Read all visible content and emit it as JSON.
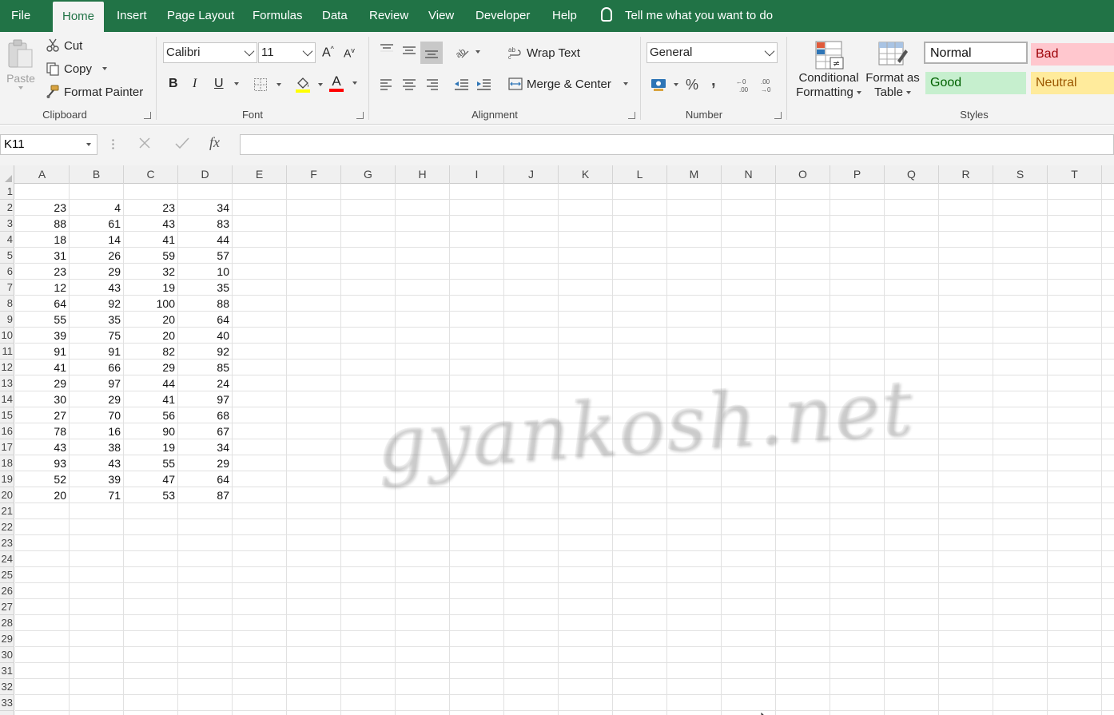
{
  "menu": {
    "tabs": [
      "File",
      "Home",
      "Insert",
      "Page Layout",
      "Formulas",
      "Data",
      "Review",
      "View",
      "Developer",
      "Help"
    ],
    "active_tab": "Home",
    "tell_me": "Tell me what you want to do"
  },
  "ribbon": {
    "clipboard": {
      "label": "Clipboard",
      "paste": "Paste",
      "cut": "Cut",
      "copy": "Copy",
      "format_painter": "Format Painter"
    },
    "font": {
      "label": "Font",
      "font_name": "Calibri",
      "font_size": "11",
      "bold": "B",
      "italic": "I",
      "underline": "U",
      "font_color_glyph": "A"
    },
    "alignment": {
      "label": "Alignment",
      "wrap_text": "Wrap Text",
      "merge_center": "Merge & Center"
    },
    "number": {
      "label": "Number",
      "format": "General",
      "percent": "%",
      "comma": ","
    },
    "styles": {
      "label": "Styles",
      "conditional_formatting_line1": "Conditional",
      "conditional_formatting_line2": "Formatting",
      "format_as_table_line1": "Format as",
      "format_as_table_line2": "Table",
      "normal": "Normal",
      "bad": "Bad",
      "good": "Good",
      "neutral": "Neutral",
      "colors": {
        "normal_bg": "#ffffff",
        "bad_bg": "#ffc7ce",
        "bad_fg": "#9c0006",
        "good_bg": "#c6efce",
        "good_fg": "#006100",
        "neutral_bg": "#ffeb9c",
        "neutral_fg": "#9c5700"
      }
    }
  },
  "formula_bar": {
    "name_box": "K11",
    "fx": "fx",
    "formula": ""
  },
  "sheet": {
    "columns": [
      "A",
      "B",
      "C",
      "D",
      "E",
      "F",
      "G",
      "H",
      "I",
      "J",
      "K",
      "L",
      "M",
      "N",
      "O",
      "P",
      "Q",
      "R",
      "S",
      "T"
    ],
    "row_numbers": [
      "1",
      "2",
      "3",
      "4",
      "5",
      "6",
      "7",
      "8",
      "9",
      "10",
      "11",
      "12",
      "13",
      "14",
      "15",
      "16",
      "17",
      "18",
      "19",
      "20",
      "21",
      "22",
      "23",
      "24",
      "25",
      "26",
      "27",
      "28",
      "29",
      "30",
      "31",
      "32",
      "33"
    ],
    "data": [
      [
        23,
        4,
        23,
        34
      ],
      [
        88,
        61,
        43,
        83
      ],
      [
        18,
        14,
        41,
        44
      ],
      [
        31,
        26,
        59,
        57
      ],
      [
        23,
        29,
        32,
        10
      ],
      [
        12,
        43,
        19,
        35
      ],
      [
        64,
        92,
        100,
        88
      ],
      [
        55,
        35,
        20,
        64
      ],
      [
        39,
        75,
        20,
        40
      ],
      [
        91,
        91,
        82,
        92
      ],
      [
        41,
        66,
        29,
        85
      ],
      [
        29,
        97,
        44,
        24
      ],
      [
        30,
        29,
        41,
        97
      ],
      [
        27,
        70,
        56,
        68
      ],
      [
        78,
        16,
        90,
        67
      ],
      [
        43,
        38,
        19,
        34
      ],
      [
        93,
        43,
        55,
        29
      ],
      [
        52,
        39,
        47,
        64
      ],
      [
        20,
        71,
        53,
        87
      ]
    ],
    "watermark": "gyankosh.net"
  },
  "theme": {
    "accent": "#217346",
    "ribbon_bg": "#f3f3f3",
    "gridline": "#e1e1e1"
  }
}
